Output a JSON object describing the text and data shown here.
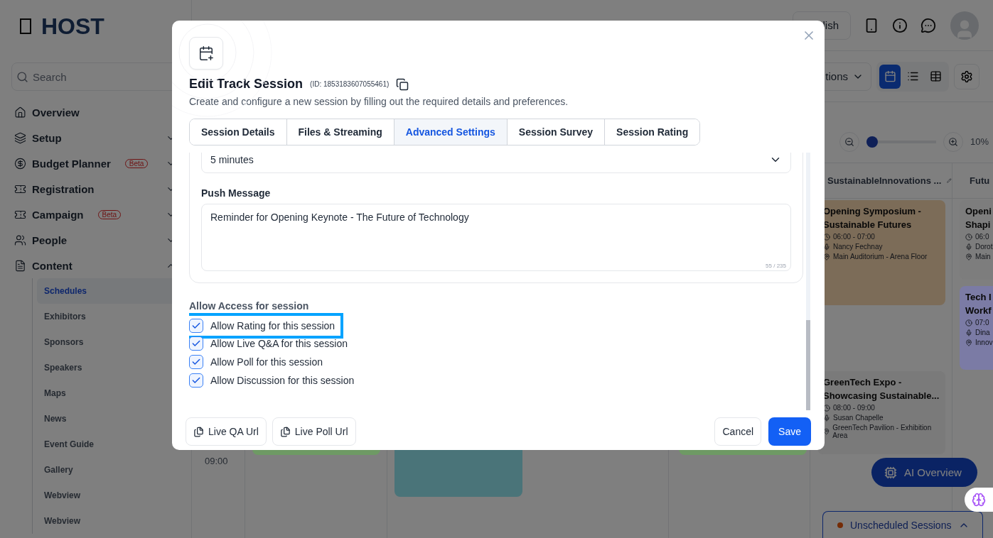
{
  "sidebar": {
    "logo": "HOST",
    "search_placeholder": "Search",
    "items": [
      {
        "label": "Overview"
      },
      {
        "label": "Setup",
        "expanded": false
      },
      {
        "label": "Budget Planner",
        "badge": "Beta",
        "expanded": false
      },
      {
        "label": "Registration",
        "expanded": false
      },
      {
        "label": "Campaign",
        "badge": "Beta",
        "expanded": false
      },
      {
        "label": "People",
        "expanded": false
      },
      {
        "label": "Content",
        "expanded": true,
        "children": [
          {
            "label": "Schedules",
            "selected": true
          },
          {
            "label": "Exhibitors",
            "selected": false
          },
          {
            "label": "Sponsors",
            "selected": false
          },
          {
            "label": "Speakers",
            "selected": false
          },
          {
            "label": "Maps",
            "selected": false
          },
          {
            "label": "News",
            "selected": false
          },
          {
            "label": "Event Guide",
            "selected": false
          },
          {
            "label": "Gallery",
            "selected": false
          },
          {
            "label": "Webview",
            "selected": false
          },
          {
            "label": "Webview",
            "selected": false
          }
        ]
      }
    ]
  },
  "header": {
    "language": "lish"
  },
  "toolbar": {
    "filter_label": "tions",
    "views": [
      {
        "kind": "calendar",
        "selected": true
      },
      {
        "kind": "list",
        "selected": false
      },
      {
        "kind": "table",
        "selected": false
      }
    ]
  },
  "zoom": {
    "level": 0,
    "reading": "10%"
  },
  "calendar": {
    "time_labels": [
      "09:00"
    ],
    "tracks": [
      {
        "sessions": [
          {
            "color": "#6e9a64"
          }
        ]
      },
      {
        "sessions": [
          {
            "color": "#4a7479"
          }
        ]
      },
      {
        "sessions": [
          {
            "color": "#6e9a64"
          }
        ]
      },
      {
        "name": "SustainableInnovations ...",
        "sessions": [
          {
            "color": "#7c6c58",
            "title_lines": [
              "Opening Symposium -",
              "Sustainable Futures"
            ],
            "time": "06:00 - 07:00",
            "speaker": "Nancy Fechnay",
            "location": "Main Auditorium - Arena Floor"
          },
          {
            "color": "#7a7a7a",
            "title_lines": [
              "GreenTech Expo -",
              "Showcasing Sustainable..."
            ],
            "time": "08:00 - 09:00",
            "speaker": "Susan Chapelle",
            "location": "GreenTech Pavilion - Exhibition Area"
          }
        ]
      },
      {
        "name": "Futu",
        "sessions": [
          {
            "color": "#7d7d7d",
            "title_lines": [
              "Openi",
              "Shapi"
            ],
            "time": "06:0",
            "speaker": "Dorot",
            "location": "Main"
          },
          {
            "color": "#7b7ba5",
            "title_lines": [
              "Tech I",
              "Workf"
            ],
            "time": "07:0",
            "speaker": "Dina",
            "location": "Innov"
          }
        ]
      }
    ]
  },
  "ai_button": "AI Overview",
  "unscheduled": {
    "label": "Unscheduled Sessions"
  },
  "modal": {
    "title": "Edit Track Session",
    "id_text": "(ID: 1853183607055461)",
    "subtitle": "Create and configure a new session by filling out the required details and preferences.",
    "tabs": [
      {
        "label": "Session Details",
        "selected": false
      },
      {
        "label": "Files & Streaming",
        "selected": false
      },
      {
        "label": "Advanced Settings",
        "selected": true
      },
      {
        "label": "Session Survey",
        "selected": false
      },
      {
        "label": "Session Rating",
        "selected": false
      }
    ],
    "reminder_value": "5 minutes",
    "push_label": "Push Message",
    "push_value": "Reminder for Opening Keynote - The Future of Technology",
    "push_counter": "55 / 235",
    "access_title": "Allow Access for session",
    "access": [
      {
        "label": "Allow Rating for this session",
        "checked": true,
        "highlighted": true
      },
      {
        "label": "Allow Live Q&A for this session",
        "checked": true,
        "highlighted": false
      },
      {
        "label": "Allow Poll for this session",
        "checked": true,
        "highlighted": false
      },
      {
        "label": "Allow Discussion for this session",
        "checked": true,
        "highlighted": false
      }
    ],
    "footer_left": [
      "Live QA Url",
      "Live Poll Url"
    ],
    "cancel": "Cancel",
    "save": "Save"
  }
}
